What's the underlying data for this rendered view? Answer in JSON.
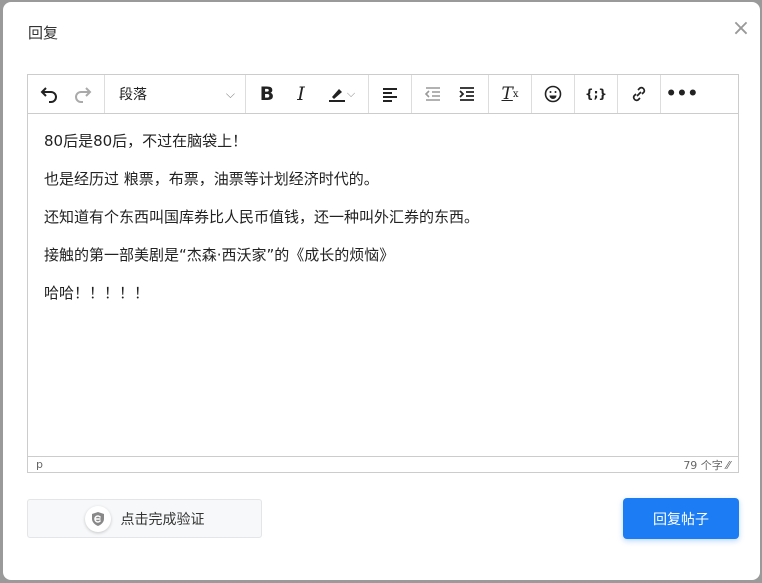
{
  "dialog": {
    "title": "回复",
    "close": "×"
  },
  "toolbar": {
    "block_format": "段落"
  },
  "content": {
    "paragraphs": [
      "80后是80后，不过在脑袋上！",
      "也是经历过 粮票，布票，油票等计划经济时代的。",
      "还知道有个东西叫国库券比人民币值钱，还一种叫外汇券的东西。",
      "接触的第一部美剧是“杰森·西沃家”的《成长的烦恼》",
      "哈哈！！！！！"
    ]
  },
  "status": {
    "path": "p",
    "word_count": "79 个字"
  },
  "verify": {
    "label": "点击完成验证"
  },
  "submit": {
    "label": "回复帖子"
  },
  "colors": {
    "accent": "#1c7cf4"
  }
}
